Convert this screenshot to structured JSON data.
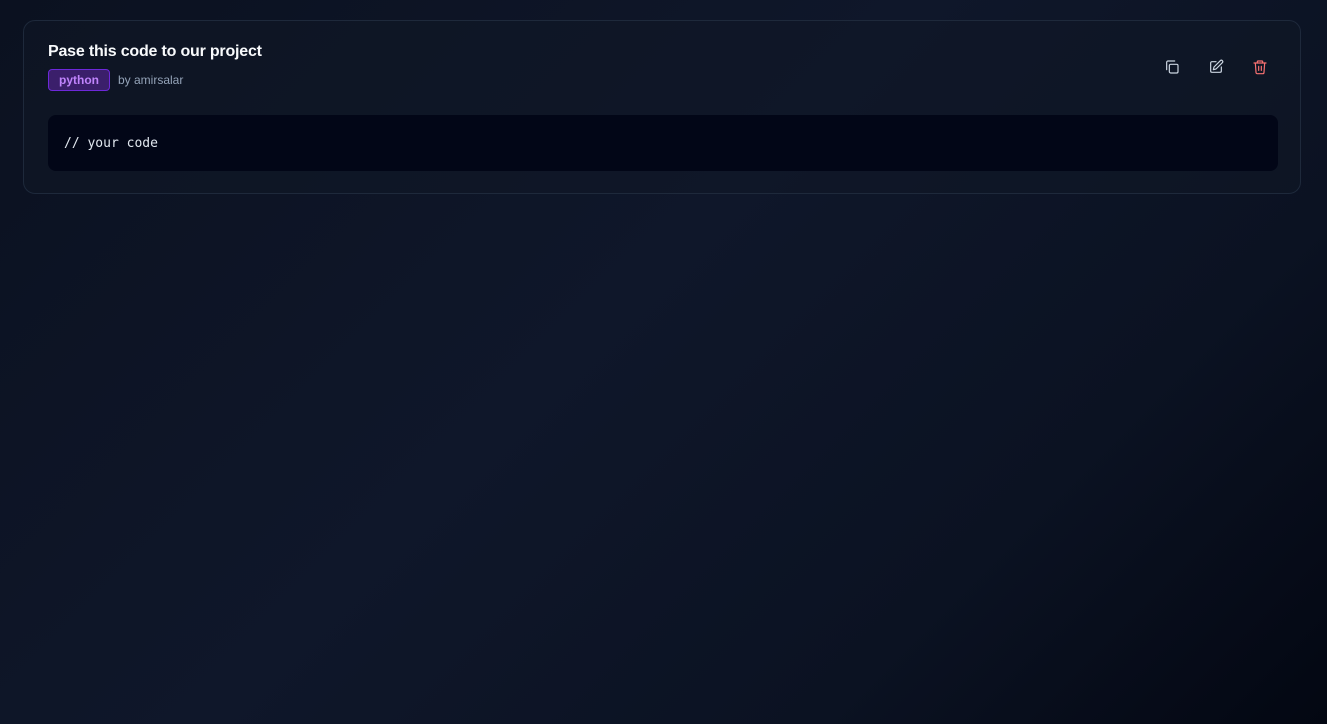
{
  "snippet": {
    "title": "Pase this code to our project",
    "language": "python",
    "author": "by amirsalar",
    "code": "// your code"
  },
  "actions": {
    "copy_icon": "copy-icon",
    "edit_icon": "edit-icon",
    "delete_icon": "trash-icon"
  },
  "colors": {
    "background": "#0f172a",
    "card_border": "#1e293b",
    "badge_bg": "#3b1f6b",
    "badge_text": "#c084fc",
    "danger": "#f87171",
    "code_bg": "#020617"
  }
}
